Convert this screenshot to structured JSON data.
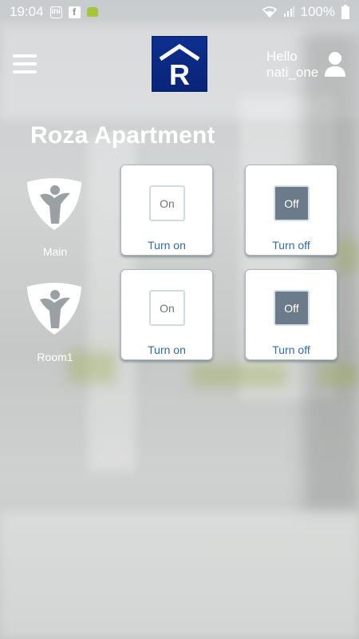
{
  "status_bar": {
    "time": "19:04",
    "battery": "100%",
    "icons": [
      "notification-icon",
      "facebook-icon",
      "android-icon",
      "wifi-icon",
      "signal-icon",
      "battery-icon"
    ]
  },
  "header": {
    "logo_letter": "R",
    "greeting_line1": "Hello",
    "greeting_line2": "nati_one"
  },
  "page": {
    "title": "Roza Apartment"
  },
  "devices": [
    {
      "name": "Main",
      "on_card": {
        "switch_text": "On",
        "label": "Turn on"
      },
      "off_card": {
        "switch_text": "Off",
        "label": "Turn off"
      }
    },
    {
      "name": "Room1",
      "on_card": {
        "switch_text": "On",
        "label": "Turn on"
      },
      "off_card": {
        "switch_text": "Off",
        "label": "Turn off"
      }
    }
  ],
  "colors": {
    "logo_bg": "#0d2f8f",
    "card_label": "#2f6ca5",
    "off_switch": "#6b7b89"
  }
}
